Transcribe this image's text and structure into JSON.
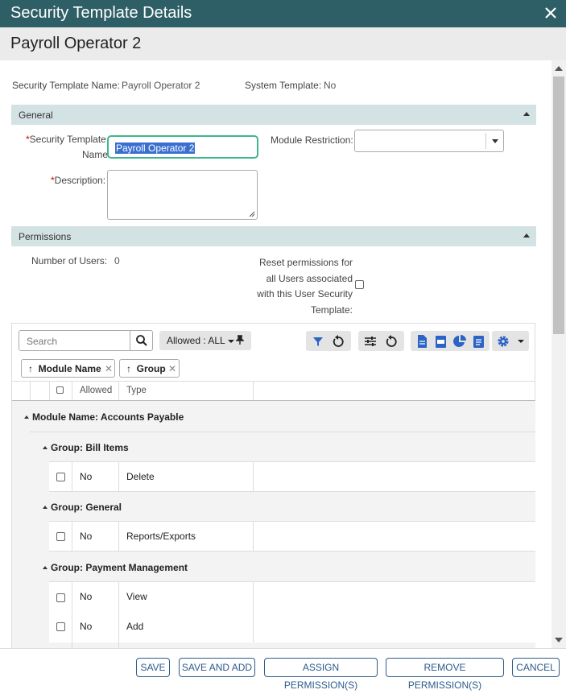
{
  "dialog": {
    "title": "Security Template Details",
    "subtitle": "Payroll Operator 2"
  },
  "summary": {
    "name_label": "Security Template Name:",
    "name_value": "Payroll Operator 2",
    "system_label": "System Template:",
    "system_value": "No"
  },
  "general": {
    "header": "General",
    "name_label_line1": "Security Template",
    "name_label_line2": "Name:",
    "required_mark": "*",
    "name_value": "Payroll Operator 2",
    "module_label": "Module Restriction:",
    "module_value": "",
    "description_label": "Description:",
    "description_value": ""
  },
  "permissions": {
    "header": "Permissions",
    "users_label": "Number of Users:",
    "users_value": "0",
    "reset_line1": "Reset permissions for",
    "reset_line2": "all Users associated",
    "reset_line3": "with this User Security",
    "reset_line4": "Template:"
  },
  "grid": {
    "search_placeholder": "Search",
    "filter_label": "Allowed : ALL",
    "chips": [
      {
        "arrow": "↑",
        "label": "Module Name"
      },
      {
        "arrow": "↑",
        "label": "Group"
      }
    ],
    "columns": {
      "allowed": "Allowed",
      "type": "Type"
    },
    "module_group": "Module Name: Accounts Payable",
    "groups": [
      {
        "label": "Group: Bill Items",
        "rows": [
          {
            "allowed": "No",
            "type": "Delete"
          }
        ]
      },
      {
        "label": "Group: General",
        "rows": [
          {
            "allowed": "No",
            "type": "Reports/Exports"
          }
        ]
      },
      {
        "label": "Group: Payment Management",
        "rows": [
          {
            "allowed": "No",
            "type": "View"
          },
          {
            "allowed": "No",
            "type": "Add"
          }
        ]
      }
    ]
  },
  "footer": {
    "save": "SAVE",
    "save_add": "SAVE AND ADD",
    "assign": "ASSIGN PERMISSION(S)",
    "remove": "REMOVE PERMISSION(S)",
    "cancel": "CANCEL"
  },
  "colors": {
    "titlebar": "#2f5f66",
    "section": "#d3e2e3",
    "accent": "#3fb68e",
    "button": "#2d5b8c",
    "icon_blue": "#2b63c6"
  }
}
